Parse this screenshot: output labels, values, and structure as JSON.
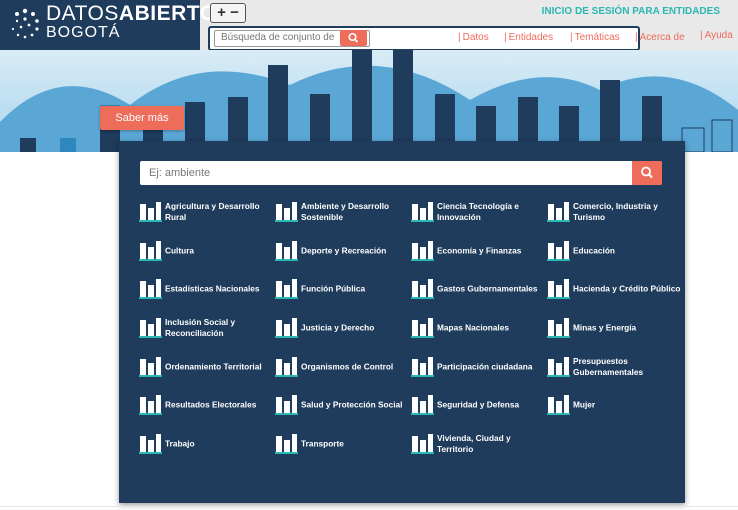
{
  "header": {
    "logo_line1_a": "DATOS",
    "logo_line1_b": "ABIERTOS",
    "logo_line2": "BOGOTÁ",
    "zoom_label": "+ −",
    "login_label": "INICIO DE SESIÓN PARA ENTIDADES",
    "search_placeholder": "Búsqueda de conjunto de",
    "nav": [
      {
        "label": "Datos"
      },
      {
        "label": "Entidades"
      },
      {
        "label": "Temáticas"
      },
      {
        "label": "Acerca de"
      },
      {
        "label": "Ayuda"
      }
    ]
  },
  "hero": {
    "button_label": "Saber más"
  },
  "panel": {
    "search_placeholder": "Ej: ambiente",
    "categories": [
      {
        "label": "Agricultura y Desarrollo Rural",
        "icon": "agriculture-icon"
      },
      {
        "label": "Ambiente y Desarrollo Sostenible",
        "icon": "environment-icon"
      },
      {
        "label": "Ciencia Tecnología e Innovación",
        "icon": "science-icon"
      },
      {
        "label": "Comercio, Industria y Turismo",
        "icon": "industry-icon"
      },
      {
        "label": "Cultura",
        "icon": "culture-icon"
      },
      {
        "label": "Deporte y Recreación",
        "icon": "sport-icon"
      },
      {
        "label": "Economía y Finanzas",
        "icon": "economy-icon"
      },
      {
        "label": "Educación",
        "icon": "education-icon"
      },
      {
        "label": "Estadísticas Nacionales",
        "icon": "statistics-icon"
      },
      {
        "label": "Función Pública",
        "icon": "public-function-icon"
      },
      {
        "label": "Gastos Gubernamentales",
        "icon": "government-spending-icon"
      },
      {
        "label": "Hacienda y Crédito Público",
        "icon": "treasury-icon"
      },
      {
        "label": "Inclusión Social y Reconciliación",
        "icon": "social-inclusion-icon"
      },
      {
        "label": "Justicia y Derecho",
        "icon": "justice-icon"
      },
      {
        "label": "Mapas Nacionales",
        "icon": "maps-icon"
      },
      {
        "label": "Minas y Energía",
        "icon": "energy-icon"
      },
      {
        "label": "Ordenamiento Territorial",
        "icon": "territorial-icon"
      },
      {
        "label": "Organismos de Control",
        "icon": "control-icon"
      },
      {
        "label": "Participación ciudadana",
        "icon": "participation-icon"
      },
      {
        "label": "Presupuestos Gubernamentales",
        "icon": "budget-icon"
      },
      {
        "label": "Resultados Electorales",
        "icon": "elections-icon"
      },
      {
        "label": "Salud y Protección Social",
        "icon": "health-icon"
      },
      {
        "label": "Seguridad y Defensa",
        "icon": "security-icon"
      },
      {
        "label": "Mujer",
        "icon": "woman-icon"
      },
      {
        "label": "Trabajo",
        "icon": "work-icon"
      },
      {
        "label": "Transporte",
        "icon": "transport-icon"
      },
      {
        "label": "Vivienda, Ciudad y Territorio",
        "icon": "housing-icon"
      }
    ]
  },
  "colors": {
    "navy": "#1f3c5c",
    "accent": "#ee6c5a",
    "teal": "#2bb7b3"
  }
}
